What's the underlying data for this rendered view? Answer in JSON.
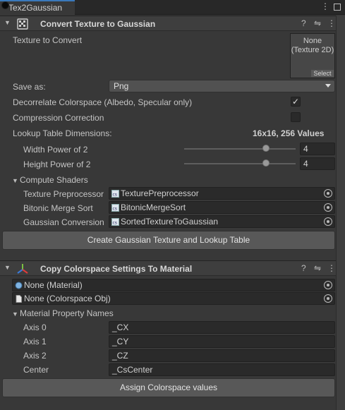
{
  "window": {
    "tab_title": "Tex2Gaussian",
    "menu_icon": "kebab-menu-icon",
    "maximize_icon": "maximize-icon"
  },
  "convert": {
    "title": "Convert Texture to Gaussian",
    "texture_label": "Texture to Convert",
    "texture_value_line1": "None",
    "texture_value_line2": "(Texture 2D)",
    "select_label": "Select",
    "save_as_label": "Save as:",
    "save_as_value": "Png",
    "decorrelate_label": "Decorrelate Colorspace (Albedo, Specular only)",
    "decorrelate_checked": true,
    "compression_label": "Compression Correction",
    "compression_checked": false,
    "lut_label": "Lookup Table Dimensions:",
    "lut_value": "16x16, 256 Values",
    "width_label": "Width Power of 2",
    "width_value": "4",
    "height_label": "Height Power of 2",
    "height_value": "4",
    "compute_label": "Compute Shaders",
    "shaders": [
      {
        "label": "Texture Preprocessor",
        "value": "TexturePreprocessor"
      },
      {
        "label": "Bitonic Merge Sort",
        "value": "BitonicMergeSort"
      },
      {
        "label": "Gaussian Conversion",
        "value": "SortedTextureToGaussian"
      }
    ],
    "create_button": "Create Gaussian Texture and Lookup Table"
  },
  "copy": {
    "title": "Copy Colorspace Settings To Material",
    "material_value": "None (Material)",
    "colorspace_value": "None (Colorspace Obj)",
    "props_label": "Material Property Names",
    "props": [
      {
        "label": "Axis 0",
        "value": "_CX"
      },
      {
        "label": "Axis 1",
        "value": "_CY"
      },
      {
        "label": "Axis 2",
        "value": "_CZ"
      },
      {
        "label": "Center",
        "value": "_CsCenter"
      }
    ],
    "assign_button": "Assign Colorspace values"
  }
}
